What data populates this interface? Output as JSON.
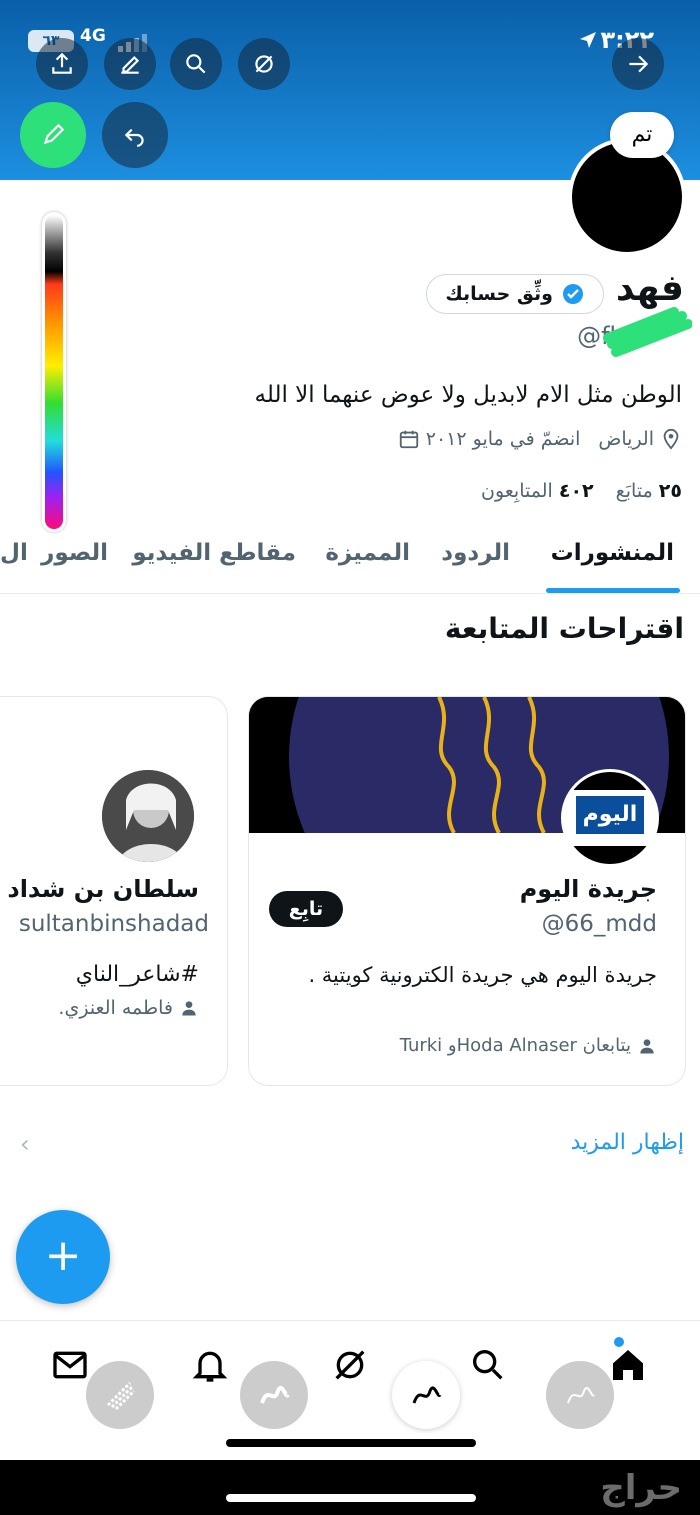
{
  "status_bar": {
    "time": "٣:٢٢",
    "network": "4G",
    "battery": "٦٣"
  },
  "markup": {
    "done_label": "تم"
  },
  "profile": {
    "name": "فهد",
    "verify_label": "وثِّق حسابك",
    "handle": "@fhd",
    "bio": "الوطن مثل الام لابديل ولا عوض عنهما الا الله",
    "location": "الرياض",
    "joined": "انضمّ في مايو ٢٠١٢",
    "following_count": "٢٥",
    "following_label": "متابَع",
    "followers_count": "٤٠٢",
    "followers_label": "المتابِعون"
  },
  "tabs": [
    {
      "label": "المنشورات"
    },
    {
      "label": "الردود"
    },
    {
      "label": "المميزة"
    },
    {
      "label": "مقاطع الفيديو"
    },
    {
      "label": "الصور"
    },
    {
      "label": "ال"
    }
  ],
  "suggestions": {
    "title": "اقتراحات المتابعة",
    "cards": [
      {
        "name": "جريدة اليوم",
        "handle": "@66_mdd",
        "bio": "جريدة اليوم هي جريدة الكترونية كويتية .",
        "followed_by": "يتابعان Hoda Alnaserو Turki",
        "follow_label": "تابِع",
        "logo_text": "اليوم"
      },
      {
        "name": "سلطان بن شداد",
        "handle": "sultanbinshadad",
        "bio": "#شاعر_الناي",
        "followed_by": "فاطمه العنزي."
      }
    ],
    "show_more": "إظهار المزيد"
  },
  "watermark": "حراج",
  "colors": {
    "accent": "#1d9bf0",
    "banner": "#1d8fe0",
    "pen": "#2ee07a"
  },
  "icons": [
    "share-icon",
    "edit-icon",
    "search-icon",
    "explore-icon",
    "arrow-right-icon",
    "pen-icon",
    "undo-icon",
    "location-icon",
    "calendar-icon",
    "mail-icon",
    "bell-icon",
    "home-icon",
    "plus-icon"
  ]
}
